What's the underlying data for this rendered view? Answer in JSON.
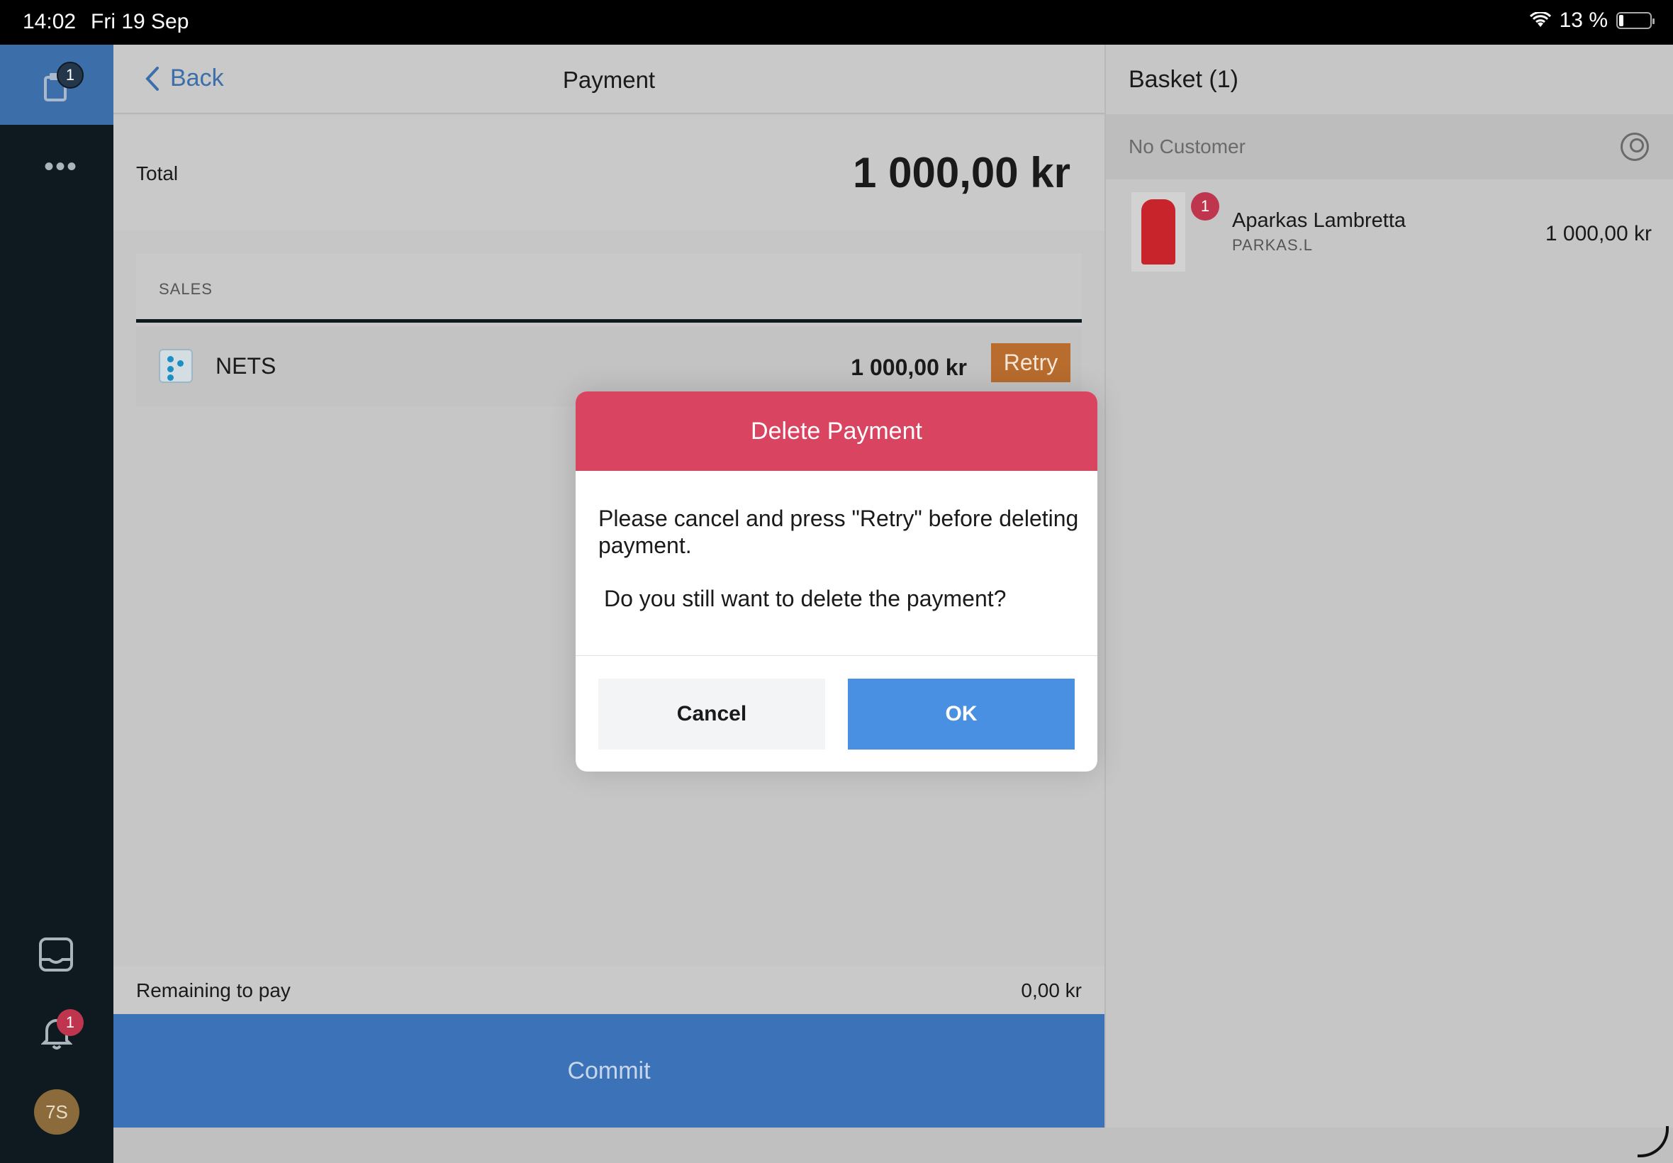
{
  "status_bar": {
    "time": "14:02",
    "date": "Fri 19 Sep",
    "battery": "13 %"
  },
  "rail": {
    "orders_badge": "1",
    "notifications_badge": "1",
    "avatar": "7S"
  },
  "payment": {
    "back_label": "Back",
    "title": "Payment",
    "total_label": "Total",
    "total_value": "1 000,00 kr",
    "section_label": "SALES",
    "method_name": "NETS",
    "method_amount": "1 000,00 kr",
    "retry_label": "Retry",
    "remaining_label": "Remaining to pay",
    "remaining_value": "0,00 kr",
    "commit_label": "Commit"
  },
  "basket": {
    "title": "Basket (1)",
    "customer_label": "No Customer",
    "items": [
      {
        "qty": "1",
        "name": "Aparkas Lambretta",
        "sku": "PARKAS.L",
        "price": "1 000,00 kr"
      }
    ]
  },
  "dialog": {
    "title": "Delete Payment",
    "message": "Please cancel and press \"Retry\" before deleting payment.",
    "question": "Do you still want to delete the payment?",
    "cancel_label": "Cancel",
    "ok_label": "OK"
  },
  "colors": {
    "accent": "#3c6eaa",
    "dialog_header": "#d94460",
    "retry": "#b86c2e",
    "ok": "#4a90e2"
  }
}
